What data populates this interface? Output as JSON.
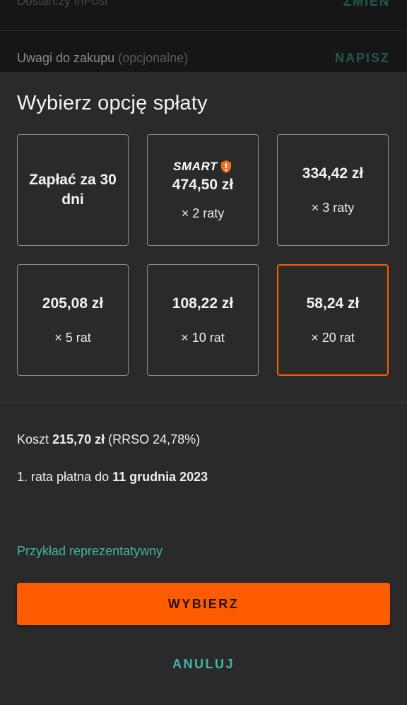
{
  "background": {
    "delivery_text": "Dostarczy InPost",
    "delivery_action": "ZMIEŃ",
    "notes_label": "Uwagi do zakupu",
    "notes_optional": "(opcjonalne)",
    "notes_action": "NAPISZ"
  },
  "sheet": {
    "title": "Wybierz opcję spłaty",
    "options": [
      {
        "title": "Zapłać za 30 dni"
      },
      {
        "badge": "SMART",
        "amount": "474,50 zł",
        "count": "× 2 raty"
      },
      {
        "amount": "334,42 zł",
        "count": "× 3 raty"
      },
      {
        "amount": "205,08 zł",
        "count": "× 5 rat"
      },
      {
        "amount": "108,22 zł",
        "count": "× 10 rat"
      },
      {
        "amount": "58,24 zł",
        "count": "× 20 rat",
        "selected": true
      }
    ],
    "cost_prefix": "Koszt",
    "cost_value": "215,70 zł",
    "cost_suffix": "(RRSO 24,78%)",
    "due_prefix": "1. rata płatna do",
    "due_date": "11 grudnia 2023",
    "example_link": "Przykład reprezentatywny",
    "confirm_button": "WYBIERZ",
    "cancel_button": "ANULUJ"
  },
  "colors": {
    "accent": "#ff5c00",
    "link": "#3fb5a5",
    "sheet_bg": "#2a2a2a"
  },
  "icons": {
    "smart_badge": "smart-logo-icon"
  }
}
